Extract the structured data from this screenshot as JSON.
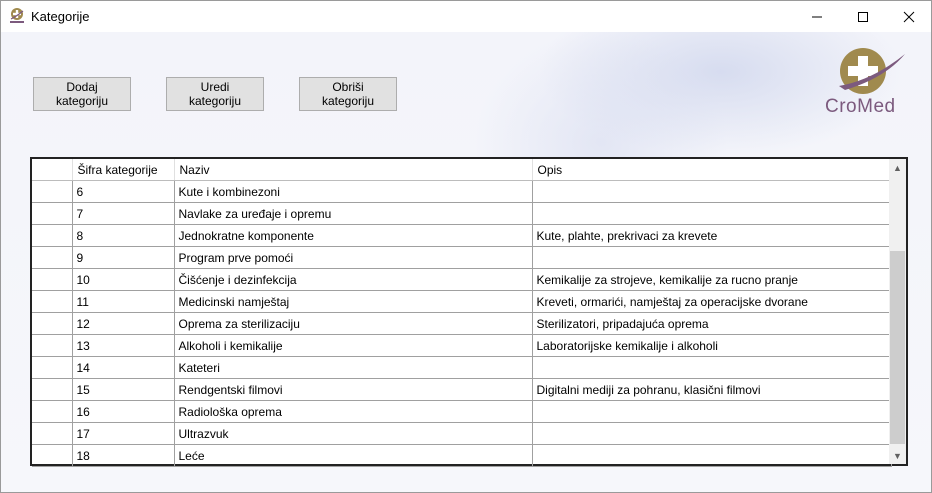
{
  "window": {
    "title": "Kategorije"
  },
  "toolbar": {
    "add_label": "Dodaj kategoriju",
    "edit_label": "Uredi kategoriju",
    "delete_label": "Obriši kategoriju"
  },
  "logo": {
    "text": "CroMed"
  },
  "table": {
    "columns": [
      "Šifra kategorije",
      "Naziv",
      "Opis"
    ],
    "rows": [
      {
        "sifra": "6",
        "naziv": "Kute i kombinezoni",
        "opis": ""
      },
      {
        "sifra": "7",
        "naziv": "Navlake za uređaje i opremu",
        "opis": ""
      },
      {
        "sifra": "8",
        "naziv": "Jednokratne komponente",
        "opis": "Kute, plahte, prekrivaci za krevete"
      },
      {
        "sifra": "9",
        "naziv": "Program prve pomoći",
        "opis": ""
      },
      {
        "sifra": "10",
        "naziv": "Čišćenje i dezinfekcija",
        "opis": "Kemikalije za strojeve, kemikalije za rucno pranje"
      },
      {
        "sifra": "11",
        "naziv": "Medicinski namještaj",
        "opis": "Kreveti, ormarići, namještaj za operacijske dvorane"
      },
      {
        "sifra": "12",
        "naziv": "Oprema za sterilizaciju",
        "opis": "Sterilizatori, pripadajuća oprema"
      },
      {
        "sifra": "13",
        "naziv": "Alkoholi i kemikalije",
        "opis": "Laboratorijske kemikalije i alkoholi"
      },
      {
        "sifra": "14",
        "naziv": "Kateteri",
        "opis": ""
      },
      {
        "sifra": "15",
        "naziv": "Rendgentski filmovi",
        "opis": "Digitalni mediji za pohranu, klasični filmovi"
      },
      {
        "sifra": "16",
        "naziv": "Radiološka oprema",
        "opis": ""
      },
      {
        "sifra": "17",
        "naziv": "Ultrazvuk",
        "opis": ""
      },
      {
        "sifra": "18",
        "naziv": "Leće",
        "opis": ""
      }
    ]
  },
  "icons": {
    "app": "cromed-app-icon",
    "minimize": "minimize-icon",
    "maximize": "maximize-icon",
    "close": "close-icon"
  },
  "colors": {
    "logo_gold": "#a08a4e",
    "logo_purple": "#7c5a7e"
  }
}
